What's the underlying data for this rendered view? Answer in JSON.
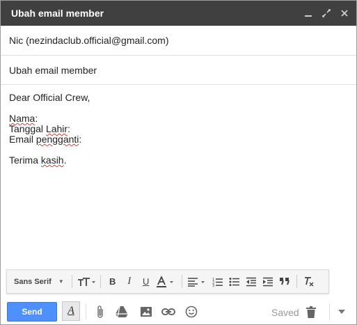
{
  "window": {
    "title": "Ubah email member",
    "controls": [
      "minimize-icon",
      "popout-icon",
      "close-icon"
    ]
  },
  "compose": {
    "to": "Nic (nezindaclub.official@gmail.com)",
    "subject": "Ubah email member",
    "body": {
      "greeting": "Dear Official Crew,",
      "field1_word": "Nama",
      "field1_suffix": ":",
      "field2_prefix": "Tanggal ",
      "field2_word": "Lahir",
      "field2_suffix": ":",
      "field3_prefix": "Email ",
      "field3_word": "pengganti",
      "field3_suffix": ":",
      "closing_prefix": "Terima ",
      "closing_word": "kasih",
      "closing_suffix": "."
    }
  },
  "format_toolbar": {
    "font": "Sans Serif",
    "buttons": [
      "text-size-icon",
      "bold-icon",
      "italic-icon",
      "underline-icon",
      "text-color-icon",
      "align-icon",
      "numbered-list-icon",
      "bulleted-list-icon",
      "indent-less-icon",
      "indent-more-icon",
      "quote-icon",
      "remove-formatting-icon"
    ]
  },
  "bottom_bar": {
    "send_label": "Send",
    "saved_label": "Saved",
    "icons": [
      "formatting-options-icon",
      "attach-icon",
      "drive-icon",
      "insert-photo-icon",
      "insert-link-icon",
      "emoji-icon",
      "discard-icon",
      "more-options-icon"
    ]
  },
  "colors": {
    "titlebar": "#404040",
    "send_button": "#4d90fe",
    "spellcheck_underline": "#e03c31"
  }
}
